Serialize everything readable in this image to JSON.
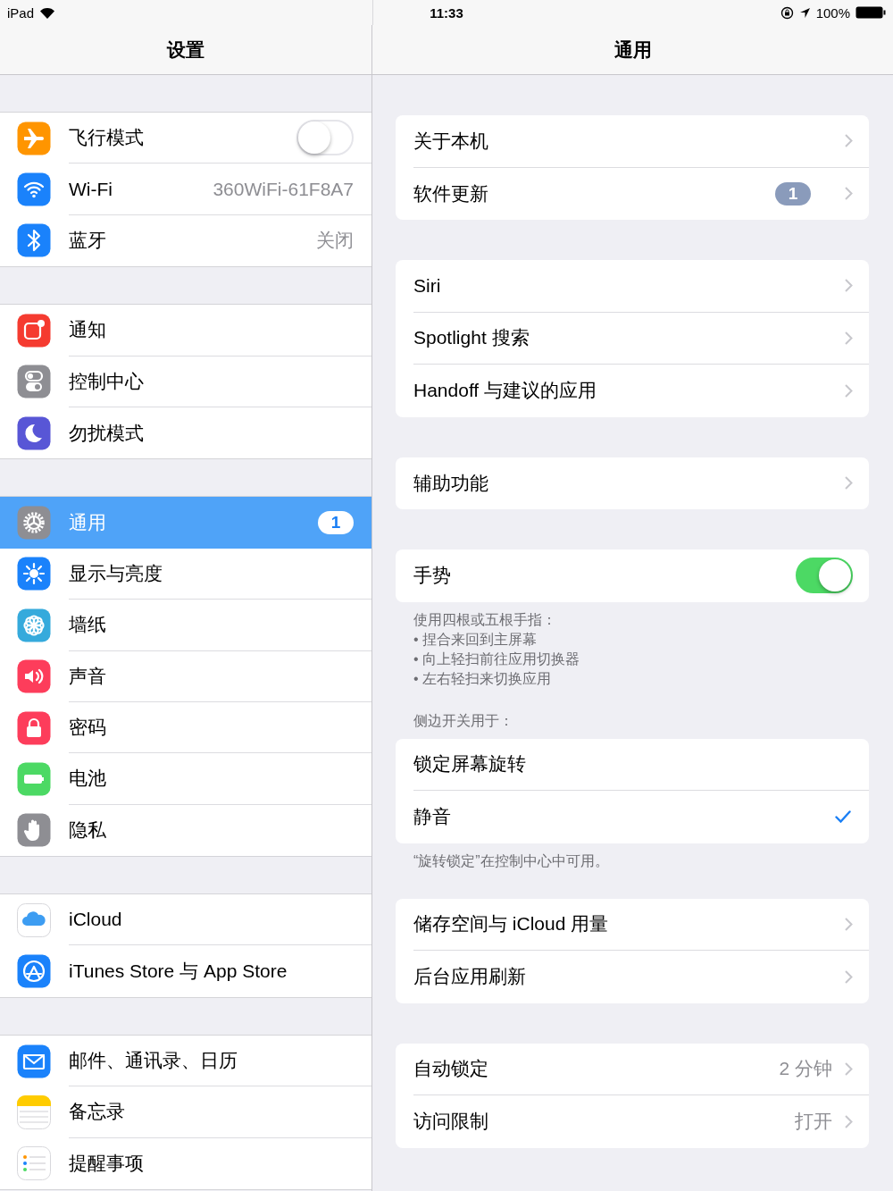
{
  "status_bar": {
    "device": "iPad",
    "time": "11:33",
    "battery": "100%"
  },
  "sidebar": {
    "title": "设置",
    "groups": [
      [
        {
          "label": "飞行模式",
          "kind": "toggle",
          "on": false,
          "selected": false
        },
        {
          "label": "Wi-Fi",
          "kind": "value",
          "value": "360WiFi-61F8A7",
          "selected": false
        },
        {
          "label": "蓝牙",
          "kind": "value",
          "value": "关闭",
          "selected": false
        }
      ],
      [
        {
          "label": "通知",
          "kind": "plain",
          "selected": false
        },
        {
          "label": "控制中心",
          "kind": "plain",
          "selected": false
        },
        {
          "label": "勿扰模式",
          "kind": "plain",
          "selected": false
        }
      ],
      [
        {
          "label": "通用",
          "kind": "badge",
          "badge": "1",
          "selected": true
        },
        {
          "label": "显示与亮度",
          "kind": "plain",
          "selected": false
        },
        {
          "label": "墙纸",
          "kind": "plain",
          "selected": false
        },
        {
          "label": "声音",
          "kind": "plain",
          "selected": false
        },
        {
          "label": "密码",
          "kind": "plain",
          "selected": false
        },
        {
          "label": "电池",
          "kind": "plain",
          "selected": false
        },
        {
          "label": "隐私",
          "kind": "plain",
          "selected": false
        }
      ],
      [
        {
          "label": "iCloud",
          "kind": "plain",
          "selected": false
        },
        {
          "label": "iTunes Store 与 App Store",
          "kind": "plain",
          "selected": false
        }
      ],
      [
        {
          "label": "邮件、通讯录、日历",
          "kind": "plain",
          "selected": false
        },
        {
          "label": "备忘录",
          "kind": "plain",
          "selected": false
        },
        {
          "label": "提醒事项",
          "kind": "plain",
          "selected": false
        }
      ]
    ]
  },
  "detail": {
    "title": "通用",
    "sections": [
      {
        "kind": "card",
        "rows": [
          {
            "label": "关于本机",
            "kind": "link"
          },
          {
            "label": "软件更新",
            "kind": "badge",
            "badge": "1"
          }
        ]
      },
      {
        "kind": "card",
        "rows": [
          {
            "label": "Siri",
            "kind": "link"
          },
          {
            "label": "Spotlight 搜索",
            "kind": "link"
          },
          {
            "label": "Handoff 与建议的应用",
            "kind": "link"
          }
        ]
      },
      {
        "kind": "card",
        "rows": [
          {
            "label": "辅助功能",
            "kind": "link"
          }
        ]
      },
      {
        "kind": "card",
        "rows": [
          {
            "label": "手势",
            "kind": "toggle",
            "on": true
          }
        ]
      },
      {
        "kind": "note",
        "lines": [
          "使用四根或五根手指：",
          "• 捏合来回到主屏幕",
          "• 向上轻扫前往应用切换器",
          "• 左右轻扫来切换应用"
        ]
      },
      {
        "kind": "header",
        "text": "侧边开关用于："
      },
      {
        "kind": "card",
        "rows": [
          {
            "label": "锁定屏幕旋转",
            "kind": "option",
            "checked": false
          },
          {
            "label": "静音",
            "kind": "option",
            "checked": true
          }
        ]
      },
      {
        "kind": "note",
        "lines": [
          "“旋转锁定”在控制中心中可用。"
        ]
      },
      {
        "kind": "card",
        "rows": [
          {
            "label": "储存空间与 iCloud 用量",
            "kind": "link"
          },
          {
            "label": "后台应用刷新",
            "kind": "link"
          }
        ]
      },
      {
        "kind": "card",
        "rows": [
          {
            "label": "自动锁定",
            "kind": "link",
            "value": "2 分钟"
          },
          {
            "label": "访问限制",
            "kind": "link",
            "value": "打开"
          }
        ]
      }
    ]
  }
}
